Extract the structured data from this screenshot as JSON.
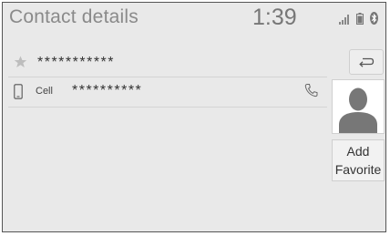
{
  "header": {
    "title": "Contact details",
    "time": "1:39"
  },
  "status": {
    "icons": [
      "signal-bars-icon",
      "battery-icon",
      "bluetooth-icon"
    ]
  },
  "contact": {
    "name_masked": "***********",
    "favorite_icon": "star-icon"
  },
  "phones": [
    {
      "type_label": "Cell",
      "number_masked": "**********",
      "type_icon": "mobile-phone-icon",
      "action_icon": "phone-handset-icon"
    }
  ],
  "actions": {
    "back_icon": "return-arrow-icon",
    "add_favorite_line1": "Add",
    "add_favorite_line2": "Favorite"
  },
  "colors": {
    "background": "#e9e9e9",
    "title": "#8a8a8a",
    "divider": "#d4d4d4"
  }
}
